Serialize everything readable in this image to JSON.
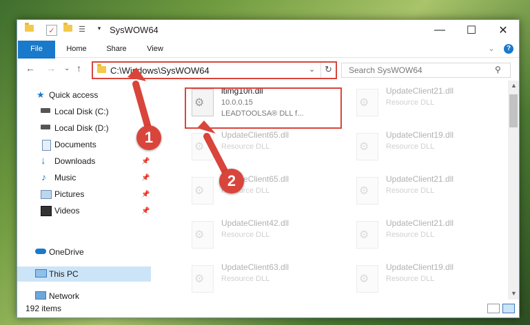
{
  "window": {
    "title": "SysWOW64",
    "quick_access_toolbar": [
      "folder-icon",
      "checkbox-icon",
      "folder-icon",
      "properties-icon",
      "dropdown-icon"
    ]
  },
  "ribbon": {
    "tabs": [
      {
        "label": "File",
        "active": true
      },
      {
        "label": "Home"
      },
      {
        "label": "Share"
      },
      {
        "label": "View"
      }
    ]
  },
  "address": {
    "path": "C:\\Windows\\SysWOW64"
  },
  "search": {
    "placeholder": "Search SysWOW64"
  },
  "sidebar": {
    "items": [
      {
        "label": "Quick access",
        "icon": "star-icon"
      },
      {
        "label": "Local Disk (C:)",
        "icon": "drive-icon"
      },
      {
        "label": "Local Disk (D:)",
        "icon": "drive-icon"
      },
      {
        "label": "Documents",
        "icon": "documents-icon"
      },
      {
        "label": "Downloads",
        "icon": "download-icon",
        "pinned": true
      },
      {
        "label": "Music",
        "icon": "music-icon",
        "pinned": true
      },
      {
        "label": "Pictures",
        "icon": "pictures-icon",
        "pinned": true
      },
      {
        "label": "Videos",
        "icon": "videos-icon",
        "pinned": true
      },
      {
        "label": "OneDrive",
        "icon": "cloud-icon"
      },
      {
        "label": "This PC",
        "icon": "pc-icon",
        "selected": true
      },
      {
        "label": "Network",
        "icon": "network-icon"
      }
    ]
  },
  "files": [
    {
      "name": "ltimg10n.dll",
      "line2": "10.0.0.15",
      "line3": "LEADTOOLSA® DLL f...",
      "highlighted": true
    },
    {
      "name": "UpdateClient21.dll",
      "line2": "Resource DLL"
    },
    {
      "name": "UpdateClient65.dll",
      "line2": "Resource DLL"
    },
    {
      "name": "UpdateClient19.dll",
      "line2": "Resource DLL"
    },
    {
      "name": "UpdateClient65.dll",
      "line2": "Resource DLL"
    },
    {
      "name": "UpdateClient21.dll",
      "line2": "Resource DLL"
    },
    {
      "name": "UpdateClient42.dll",
      "line2": "Resource DLL"
    },
    {
      "name": "UpdateClient21.dll",
      "line2": "Resource DLL"
    },
    {
      "name": "UpdateClient63.dll",
      "line2": "Resource DLL"
    },
    {
      "name": "UpdateClient19.dll",
      "line2": "Resource DLL"
    }
  ],
  "status": {
    "item_count": "192 items"
  },
  "annotations": {
    "marker1": "1",
    "marker2": "2"
  },
  "colors": {
    "accent": "#1979ca",
    "highlight": "#d9443b"
  }
}
